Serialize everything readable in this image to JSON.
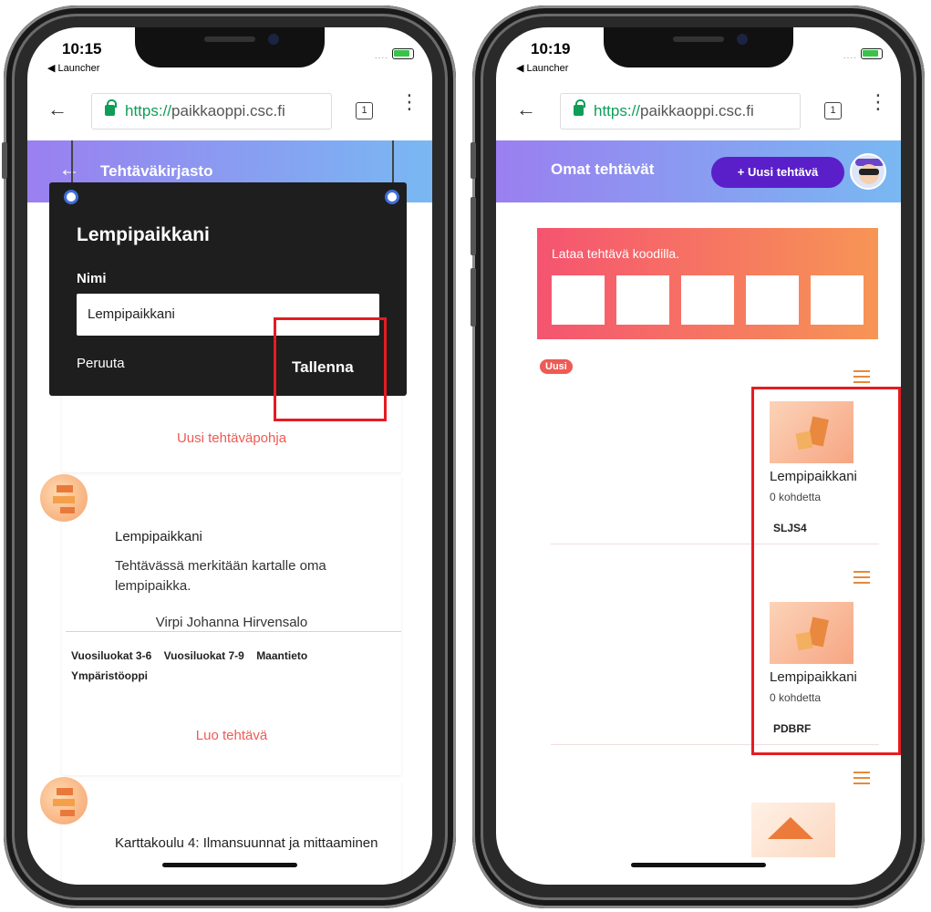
{
  "left": {
    "status": {
      "time": "10:15",
      "back": "◀ Launcher"
    },
    "browser": {
      "scheme": "https://",
      "host": "paikkaoppi.csc.fi",
      "tabs": "1"
    },
    "header": {
      "title": "Tehtäväkirjasto"
    },
    "dialog": {
      "title": "Lempipaikkani",
      "name_label": "Nimi",
      "name_value": "Lempipaikkani",
      "cancel": "Peruuta",
      "save": "Tallenna"
    },
    "new_template": "Uusi tehtäväpohja",
    "task": {
      "name": "Lempipaikkani",
      "description": "Tehtävässä merkitään kartalle oma lempipaikka.",
      "author": "Virpi Johanna Hirvensalo",
      "tags": [
        "Vuosiluokat 3-6",
        "Vuosiluokat 7-9",
        "Maantieto",
        "Ympäristöoppi"
      ],
      "create": "Luo tehtävä"
    },
    "next_task": {
      "name": "Karttakoulu 4: Ilmansuunnat ja mittaaminen"
    }
  },
  "right": {
    "status": {
      "time": "10:19",
      "back": "◀ Launcher"
    },
    "browser": {
      "scheme": "https://",
      "host": "paikkaoppi.csc.fi",
      "tabs": "1"
    },
    "header": {
      "title": "Omat tehtävät",
      "new_button": "+ Uusi tehtävä"
    },
    "code_prompt": "Lataa tehtävä koodilla.",
    "badge": "Uusi",
    "tasks": [
      {
        "name": "Lempipaikkani",
        "count": "0 kohdetta",
        "code": "SLJS4"
      },
      {
        "name": "Lempipaikkani",
        "count": "0 kohdetta",
        "code": "PDBRF"
      }
    ]
  },
  "colors": {
    "accent": "#ee5a54",
    "header_from": "#9a7ff0",
    "header_to": "#79b8f2",
    "highlight": "#e51c23",
    "button": "#5a1fc9"
  }
}
